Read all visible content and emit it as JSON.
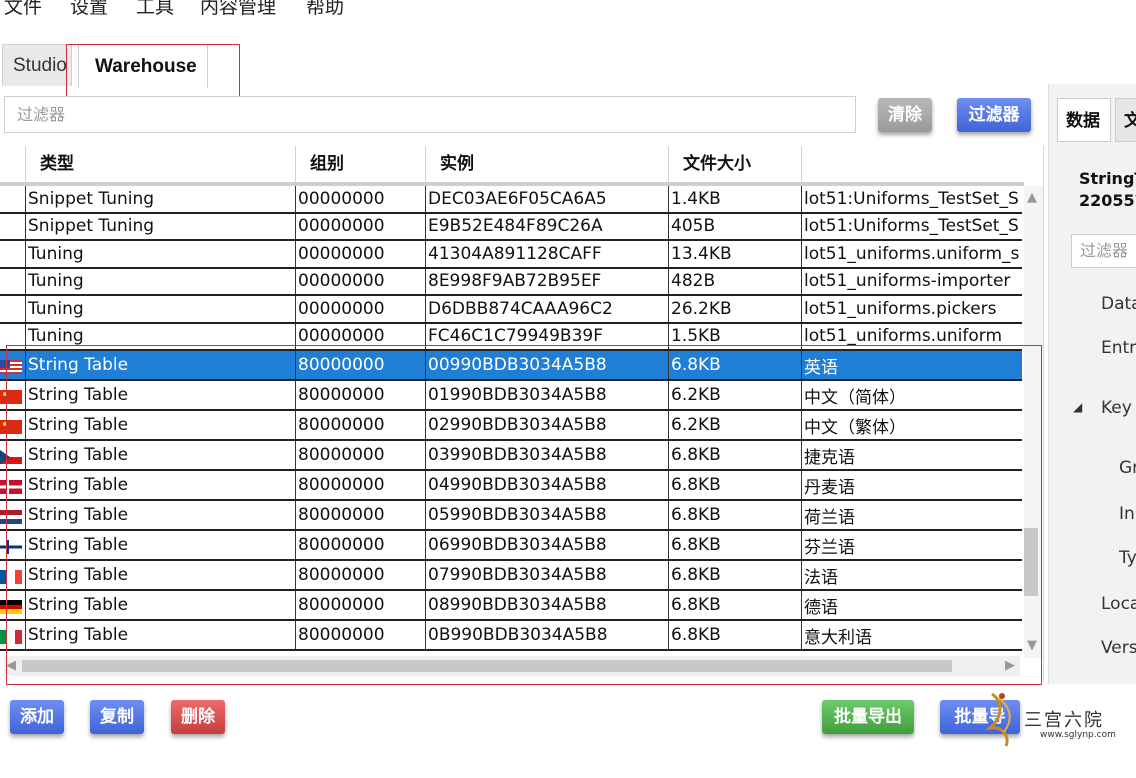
{
  "menu": [
    "文件",
    "设置",
    "工具",
    "内容管理",
    "帮助"
  ],
  "tabs": {
    "studio": "Studio",
    "warehouse": "Warehouse"
  },
  "filter": {
    "placeholder": "过滤器",
    "clear_label": "清除",
    "filter_label": "过滤器"
  },
  "columns": [
    "类型",
    "组别",
    "实例",
    "文件大小",
    ""
  ],
  "rows": [
    {
      "flag": "",
      "type": "Snippet Tuning",
      "group": "00000000",
      "instance": "DEC03AE6F05CA6A5",
      "size": "1.4KB",
      "name": "lot51:Uniforms_TestSet_S"
    },
    {
      "flag": "",
      "type": "Snippet Tuning",
      "group": "00000000",
      "instance": "E9B52E484F89C26A",
      "size": "405B",
      "name": "lot51:Uniforms_TestSet_S"
    },
    {
      "flag": "",
      "type": "Tuning",
      "group": "00000000",
      "instance": "41304A891128CAFF",
      "size": "13.4KB",
      "name": "lot51_uniforms.uniform_s"
    },
    {
      "flag": "",
      "type": "Tuning",
      "group": "00000000",
      "instance": "8E998F9AB72B95EF",
      "size": "482B",
      "name": "lot51_uniforms-importer"
    },
    {
      "flag": "",
      "type": "Tuning",
      "group": "00000000",
      "instance": "D6DBB874CAAA96C2",
      "size": "26.2KB",
      "name": "lot51_uniforms.pickers"
    },
    {
      "flag": "",
      "type": "Tuning",
      "group": "00000000",
      "instance": "FC46C1C79949B39F",
      "size": "1.5KB",
      "name": "lot51_uniforms.uniform"
    },
    {
      "flag": "us",
      "type": "String Table",
      "group": "80000000",
      "instance": "00990BDB3034A5B8",
      "size": "6.8KB",
      "name": "英语",
      "selected": true
    },
    {
      "flag": "cn",
      "type": "String Table",
      "group": "80000000",
      "instance": "01990BDB3034A5B8",
      "size": "6.2KB",
      "name": "中文（简体）"
    },
    {
      "flag": "cn",
      "type": "String Table",
      "group": "80000000",
      "instance": "02990BDB3034A5B8",
      "size": "6.2KB",
      "name": "中文（繁体）"
    },
    {
      "flag": "cz",
      "type": "String Table",
      "group": "80000000",
      "instance": "03990BDB3034A5B8",
      "size": "6.8KB",
      "name": "捷克语"
    },
    {
      "flag": "dk",
      "type": "String Table",
      "group": "80000000",
      "instance": "04990BDB3034A5B8",
      "size": "6.8KB",
      "name": "丹麦语"
    },
    {
      "flag": "nl",
      "type": "String Table",
      "group": "80000000",
      "instance": "05990BDB3034A5B8",
      "size": "6.8KB",
      "name": "荷兰语"
    },
    {
      "flag": "fi",
      "type": "String Table",
      "group": "80000000",
      "instance": "06990BDB3034A5B8",
      "size": "6.8KB",
      "name": "芬兰语"
    },
    {
      "flag": "fr",
      "type": "String Table",
      "group": "80000000",
      "instance": "07990BDB3034A5B8",
      "size": "6.8KB",
      "name": "法语"
    },
    {
      "flag": "de",
      "type": "String Table",
      "group": "80000000",
      "instance": "08990BDB3034A5B8",
      "size": "6.8KB",
      "name": "德语"
    },
    {
      "flag": "it",
      "type": "String Table",
      "group": "80000000",
      "instance": "0B990BDB3034A5B8",
      "size": "6.8KB",
      "name": "意大利语"
    }
  ],
  "bottom_buttons": {
    "add": "添加",
    "copy": "复制",
    "delete": "删除",
    "batch_export": "批量导出",
    "batch_export2": "批量导"
  },
  "side": {
    "tabs": [
      "数据",
      "文"
    ],
    "title_line1": "StringT",
    "title_line2": "220557",
    "filter_placeholder": "过滤器",
    "props": [
      "Data",
      "Entr",
      "Key",
      "Gr",
      "In",
      "Ty",
      "Loca",
      "Vers"
    ]
  },
  "watermark": {
    "text": "三宫六院",
    "url": "www.sglynp.com"
  },
  "colors": {
    "selection": "#1f7fd6",
    "highlight_box": "#c8323a"
  }
}
